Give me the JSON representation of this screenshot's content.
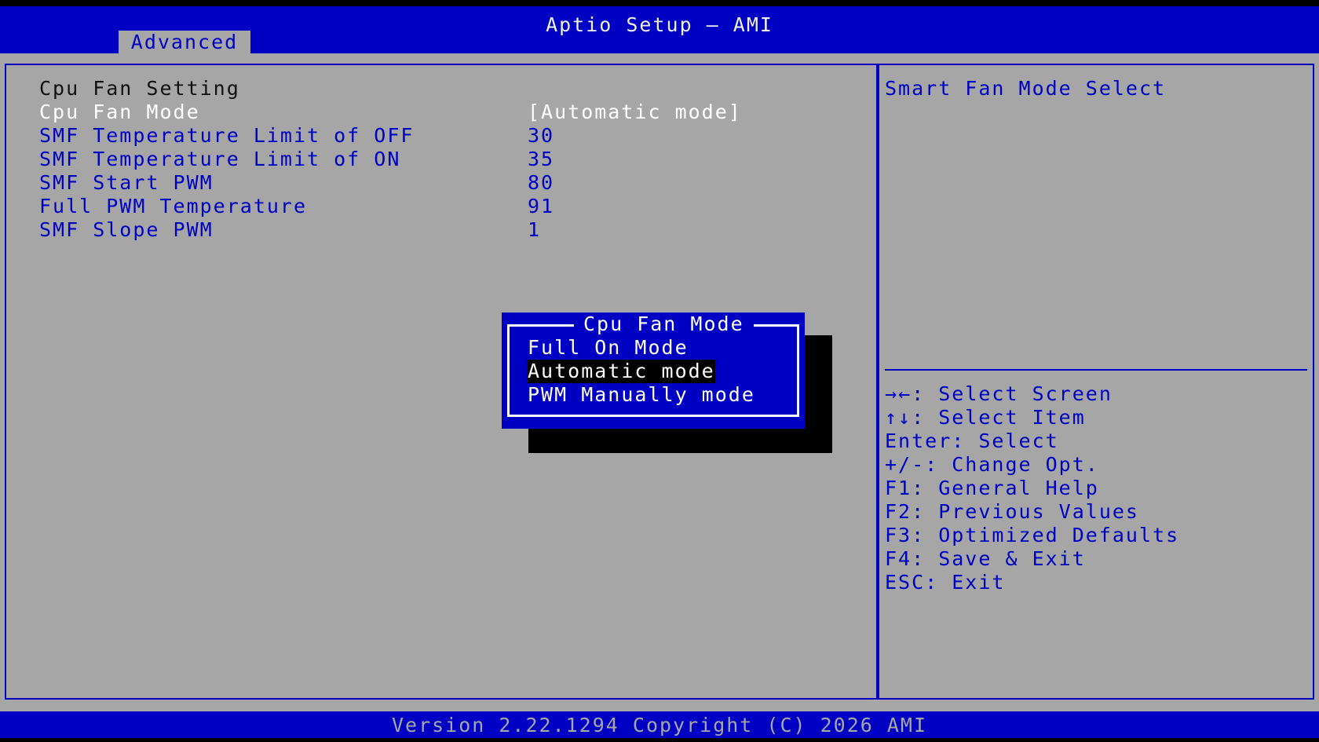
{
  "window": {
    "title": "Aptio Setup – AMI"
  },
  "tabs": [
    {
      "label": "Advanced",
      "active": true
    }
  ],
  "settings": {
    "section_title": "Cpu Fan Setting",
    "items": [
      {
        "label": "Cpu Fan Mode",
        "value": "[Automatic mode]",
        "selected": true
      },
      {
        "label": "SMF Temperature Limit of OFF",
        "value": "30"
      },
      {
        "label": "SMF Temperature Limit of ON",
        "value": "35"
      },
      {
        "label": "SMF Start PWM",
        "value": "80"
      },
      {
        "label": "Full PWM Temperature",
        "value": "91"
      },
      {
        "label": "SMF Slope PWM",
        "value": "1"
      }
    ]
  },
  "help": {
    "description": "Smart Fan Mode Select",
    "keys": [
      "→←: Select Screen",
      "↑↓: Select Item",
      "Enter: Select",
      "+/-: Change Opt.",
      "F1: General Help",
      "F2: Previous Values",
      "F3: Optimized Defaults",
      "F4: Save & Exit",
      "ESC: Exit"
    ]
  },
  "popup": {
    "title": "Cpu Fan Mode",
    "options": [
      "Full On Mode",
      "Automatic mode",
      "PWM Manually mode"
    ],
    "selected_index": 1
  },
  "footer": {
    "text": "Version 2.22.1294 Copyright (C) 2026 AMI"
  },
  "colors": {
    "bios_blue": "#0000c4",
    "panel_gray": "#a6a6a6",
    "selected_text": "#ffffff"
  }
}
